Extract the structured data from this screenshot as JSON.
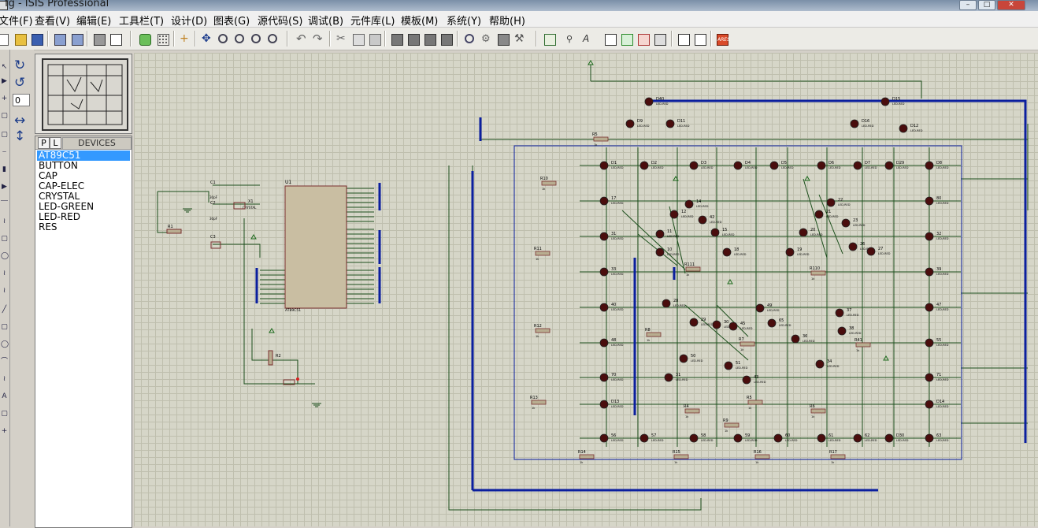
{
  "window": {
    "title": "fg - ISIS Professional"
  },
  "menu": [
    "文件(F)",
    "查看(V)",
    "编辑(E)",
    "工具栏(T)",
    "设计(D)",
    "图表(G)",
    "源代码(S)",
    "调试(B)",
    "元件库(L)",
    "模板(M)",
    "系统(Y)",
    "帮助(H)"
  ],
  "toolbar": {
    "icons": [
      "new-icon",
      "open-icon",
      "save-icon",
      "import-icon",
      "export-icon",
      "print-icon",
      "print-area-icon",
      "refresh-icon",
      "grid-icon",
      "origin-icon",
      "pan-icon",
      "zoom-in-icon",
      "zoom-out-icon",
      "zoom-all-icon",
      "zoom-area-icon",
      "undo-icon",
      "redo-icon",
      "cut-icon",
      "copy-icon",
      "paste-icon",
      "block-copy-icon",
      "block-move-icon",
      "block-rotate-icon",
      "block-delete-icon",
      "pick-device-icon",
      "make-device-icon",
      "package-icon",
      "decompose-icon",
      "wire-autorouter-icon",
      "search-tag-icon",
      "property-assign-icon",
      "new-sheet-icon",
      "remove-sheet-icon",
      "exit-to-parent-icon",
      "bill-of-materials-icon",
      "electrical-rule-check-icon",
      "ares-icon"
    ],
    "ares_label": "ARES"
  },
  "rotation": {
    "angle": "0"
  },
  "device_panel": {
    "btn_p": "P",
    "btn_l": "L",
    "title": "DEVICES",
    "items": [
      "AT89C51",
      "BUTTON",
      "CAP",
      "CAP-ELEC",
      "CRYSTAL",
      "LED-GREEN",
      "LED-RED",
      "RES"
    ],
    "selected_index": 0
  },
  "schematic": {
    "mcu": {
      "ref": "U1",
      "part": "AT89C51"
    },
    "crystal_circuit": {
      "c1": "C1",
      "c2": "C2",
      "x1": "X1",
      "xtal": "CRYSTAL",
      "c3": "C3",
      "r1": "R1",
      "r2": "R2",
      "cap_val": "30pF"
    },
    "led_type": "LED-RED",
    "leds": [
      "D40",
      "D15",
      "D9",
      "D11",
      "D16",
      "D12",
      "D1",
      "D2",
      "D3",
      "D4",
      "D5",
      "D6",
      "D7",
      "D29",
      "D8",
      "17",
      "80",
      "31",
      "32",
      "33",
      "39",
      "40",
      "47",
      "48",
      "55",
      "70",
      "71",
      "D13",
      "D14",
      "56",
      "57",
      "58",
      "59",
      "60",
      "61",
      "62",
      "D30",
      "63",
      "11",
      "12",
      "14",
      "42",
      "15",
      "10",
      "18",
      "22",
      "21",
      "23",
      "20",
      "26",
      "27",
      "19",
      "28",
      "29",
      "30",
      "45",
      "49",
      "65",
      "36",
      "37",
      "38",
      "50",
      "51",
      "43",
      "31",
      "34",
      "41",
      "52"
    ],
    "resistors": [
      "R5",
      "R10",
      "R11",
      "R12",
      "R13",
      "R14",
      "R15",
      "R16",
      "R17",
      "R111",
      "R110",
      "R8",
      "R7",
      "R41",
      "R4",
      "R9",
      "R6",
      "R5"
    ],
    "res_value": "1k"
  }
}
